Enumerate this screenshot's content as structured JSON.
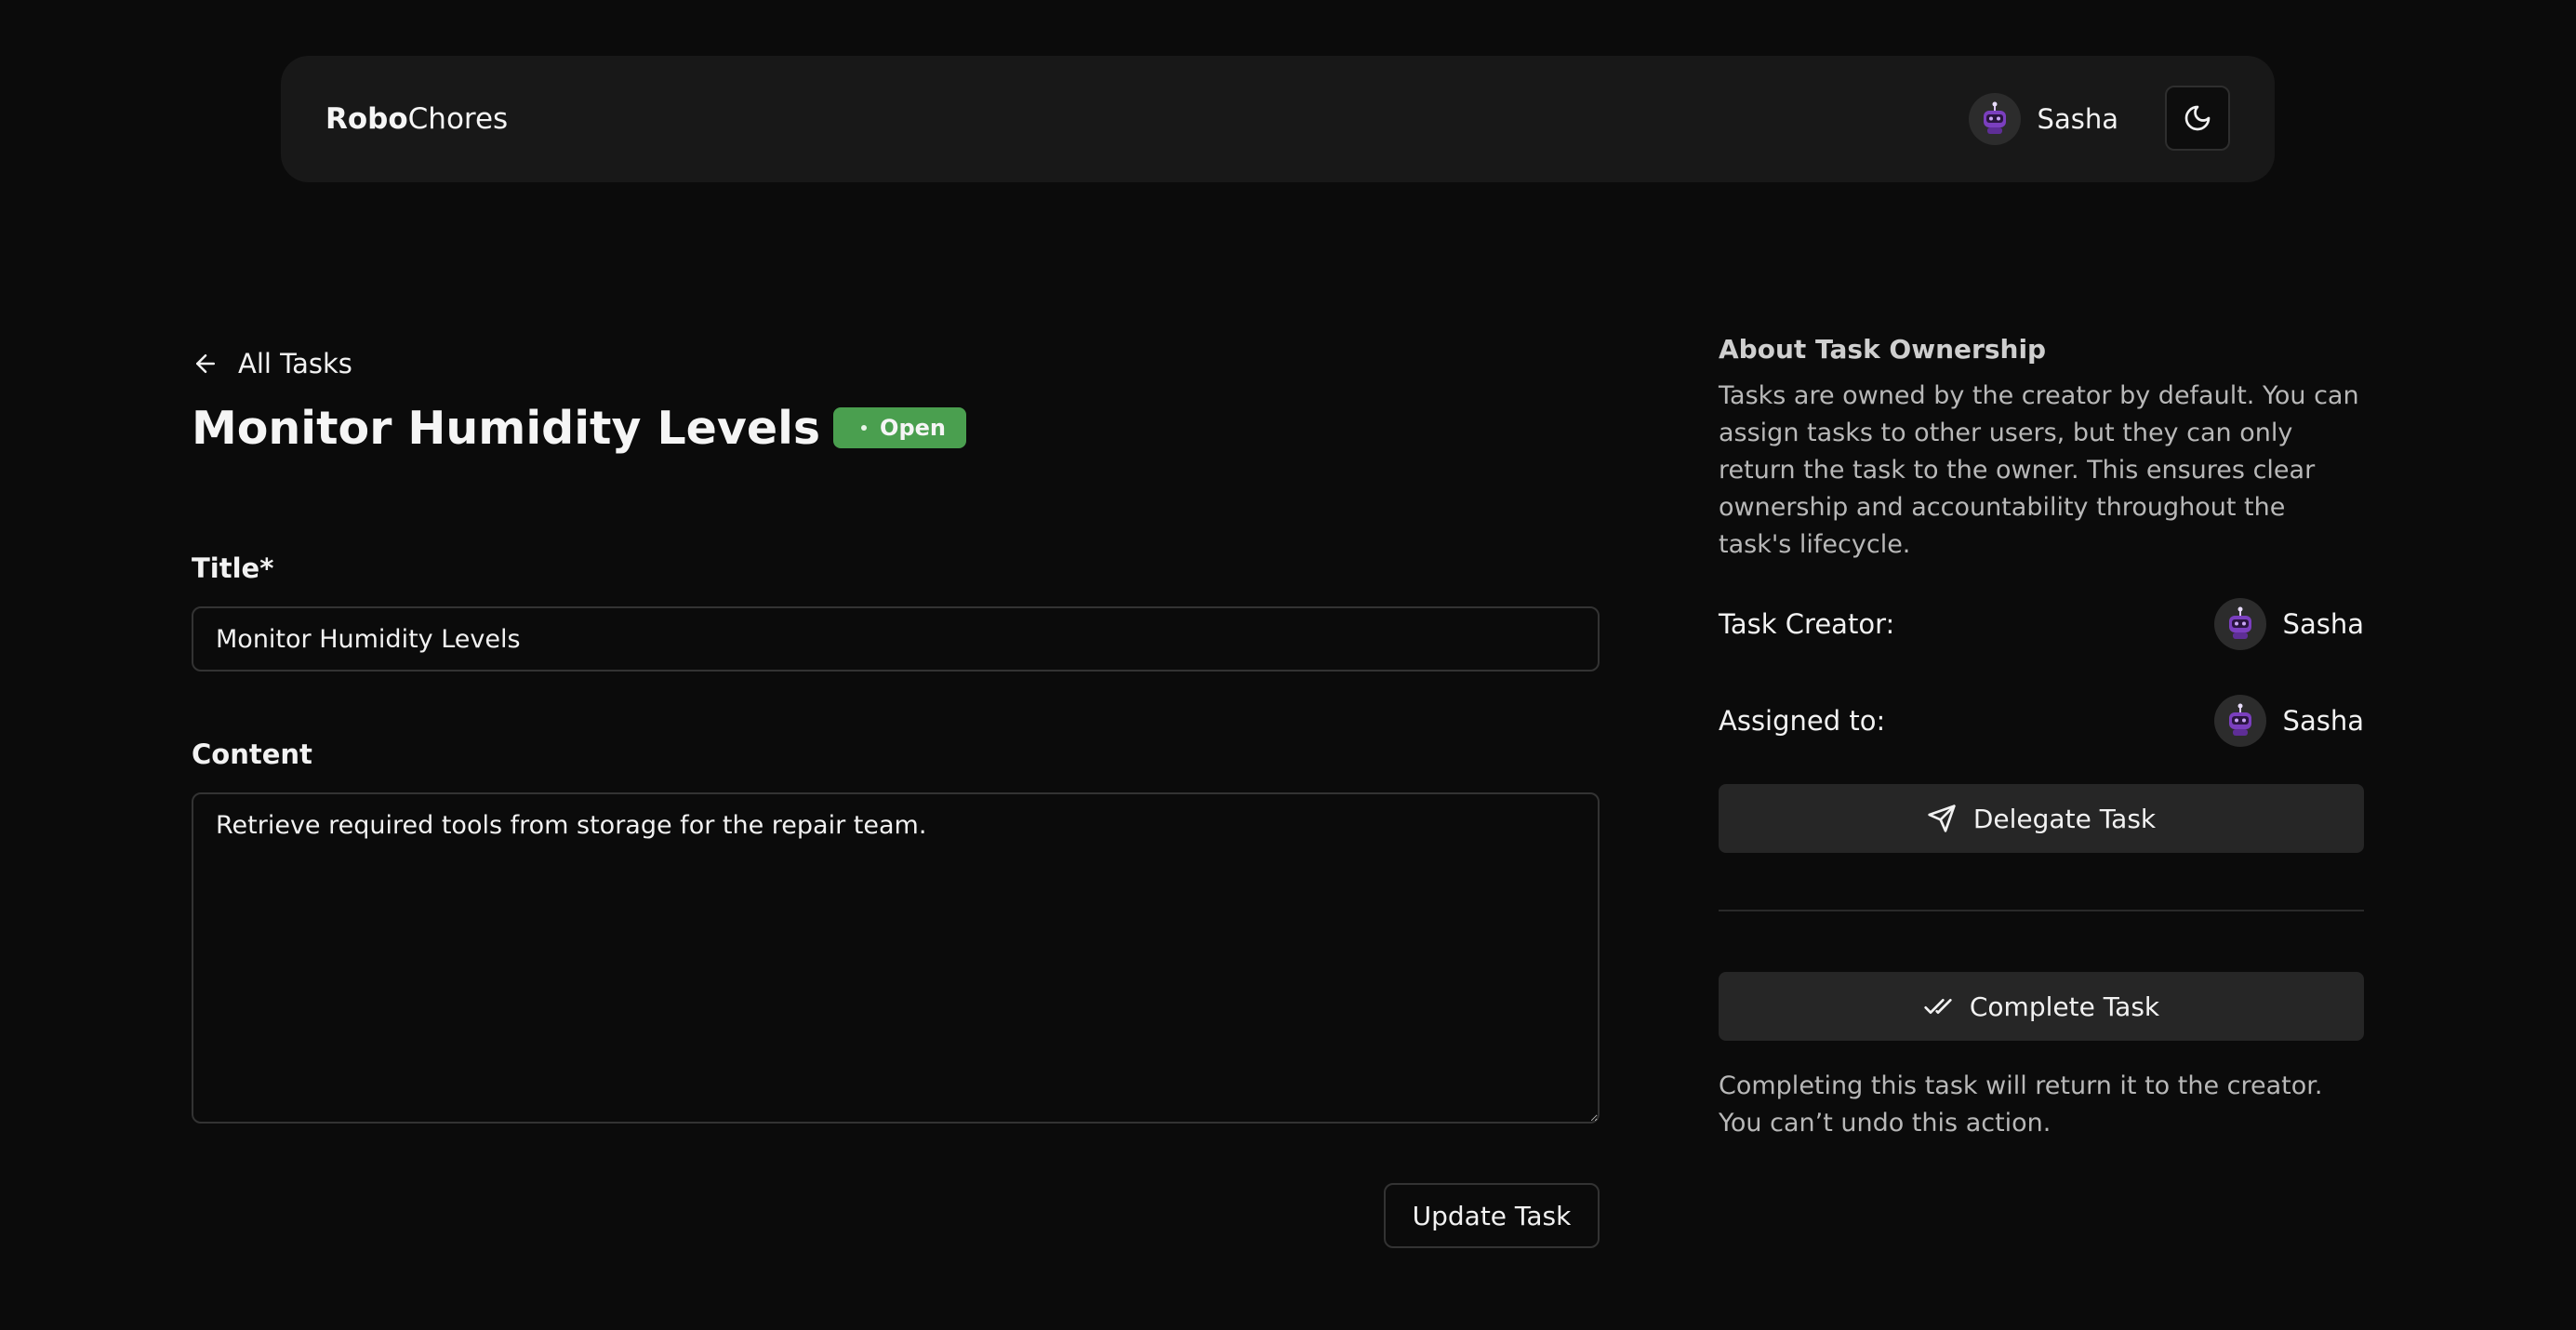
{
  "header": {
    "logo_bold": "Robo",
    "logo_light": "Chores",
    "user_name": "Sasha",
    "avatar_icon": "robot-avatar-icon",
    "theme_icon": "moon-icon"
  },
  "task": {
    "back_label": "All Tasks",
    "title": "Monitor Humidity Levels",
    "status": "Open",
    "status_color": "#4a9f4f"
  },
  "form": {
    "title_label": "Title*",
    "title_value": "Monitor Humidity Levels",
    "content_label": "Content",
    "content_value": "Retrieve required tools from storage for the repair team.",
    "update_button": "Update Task"
  },
  "sidebar": {
    "about_title": "About Task Ownership",
    "about_text": "Tasks are owned by the creator by default. You can assign tasks to other users, but they can only return the task to the owner. This ensures clear ownership and accountability throughout the task's lifecycle.",
    "creator_label": "Task Creator:",
    "creator_name": "Sasha",
    "assignee_label": "Assigned to:",
    "assignee_name": "Sasha",
    "delegate_button": "Delegate Task",
    "complete_button": "Complete Task",
    "complete_warning": "Completing this task will return it to the creator. You can’t undo this action."
  }
}
